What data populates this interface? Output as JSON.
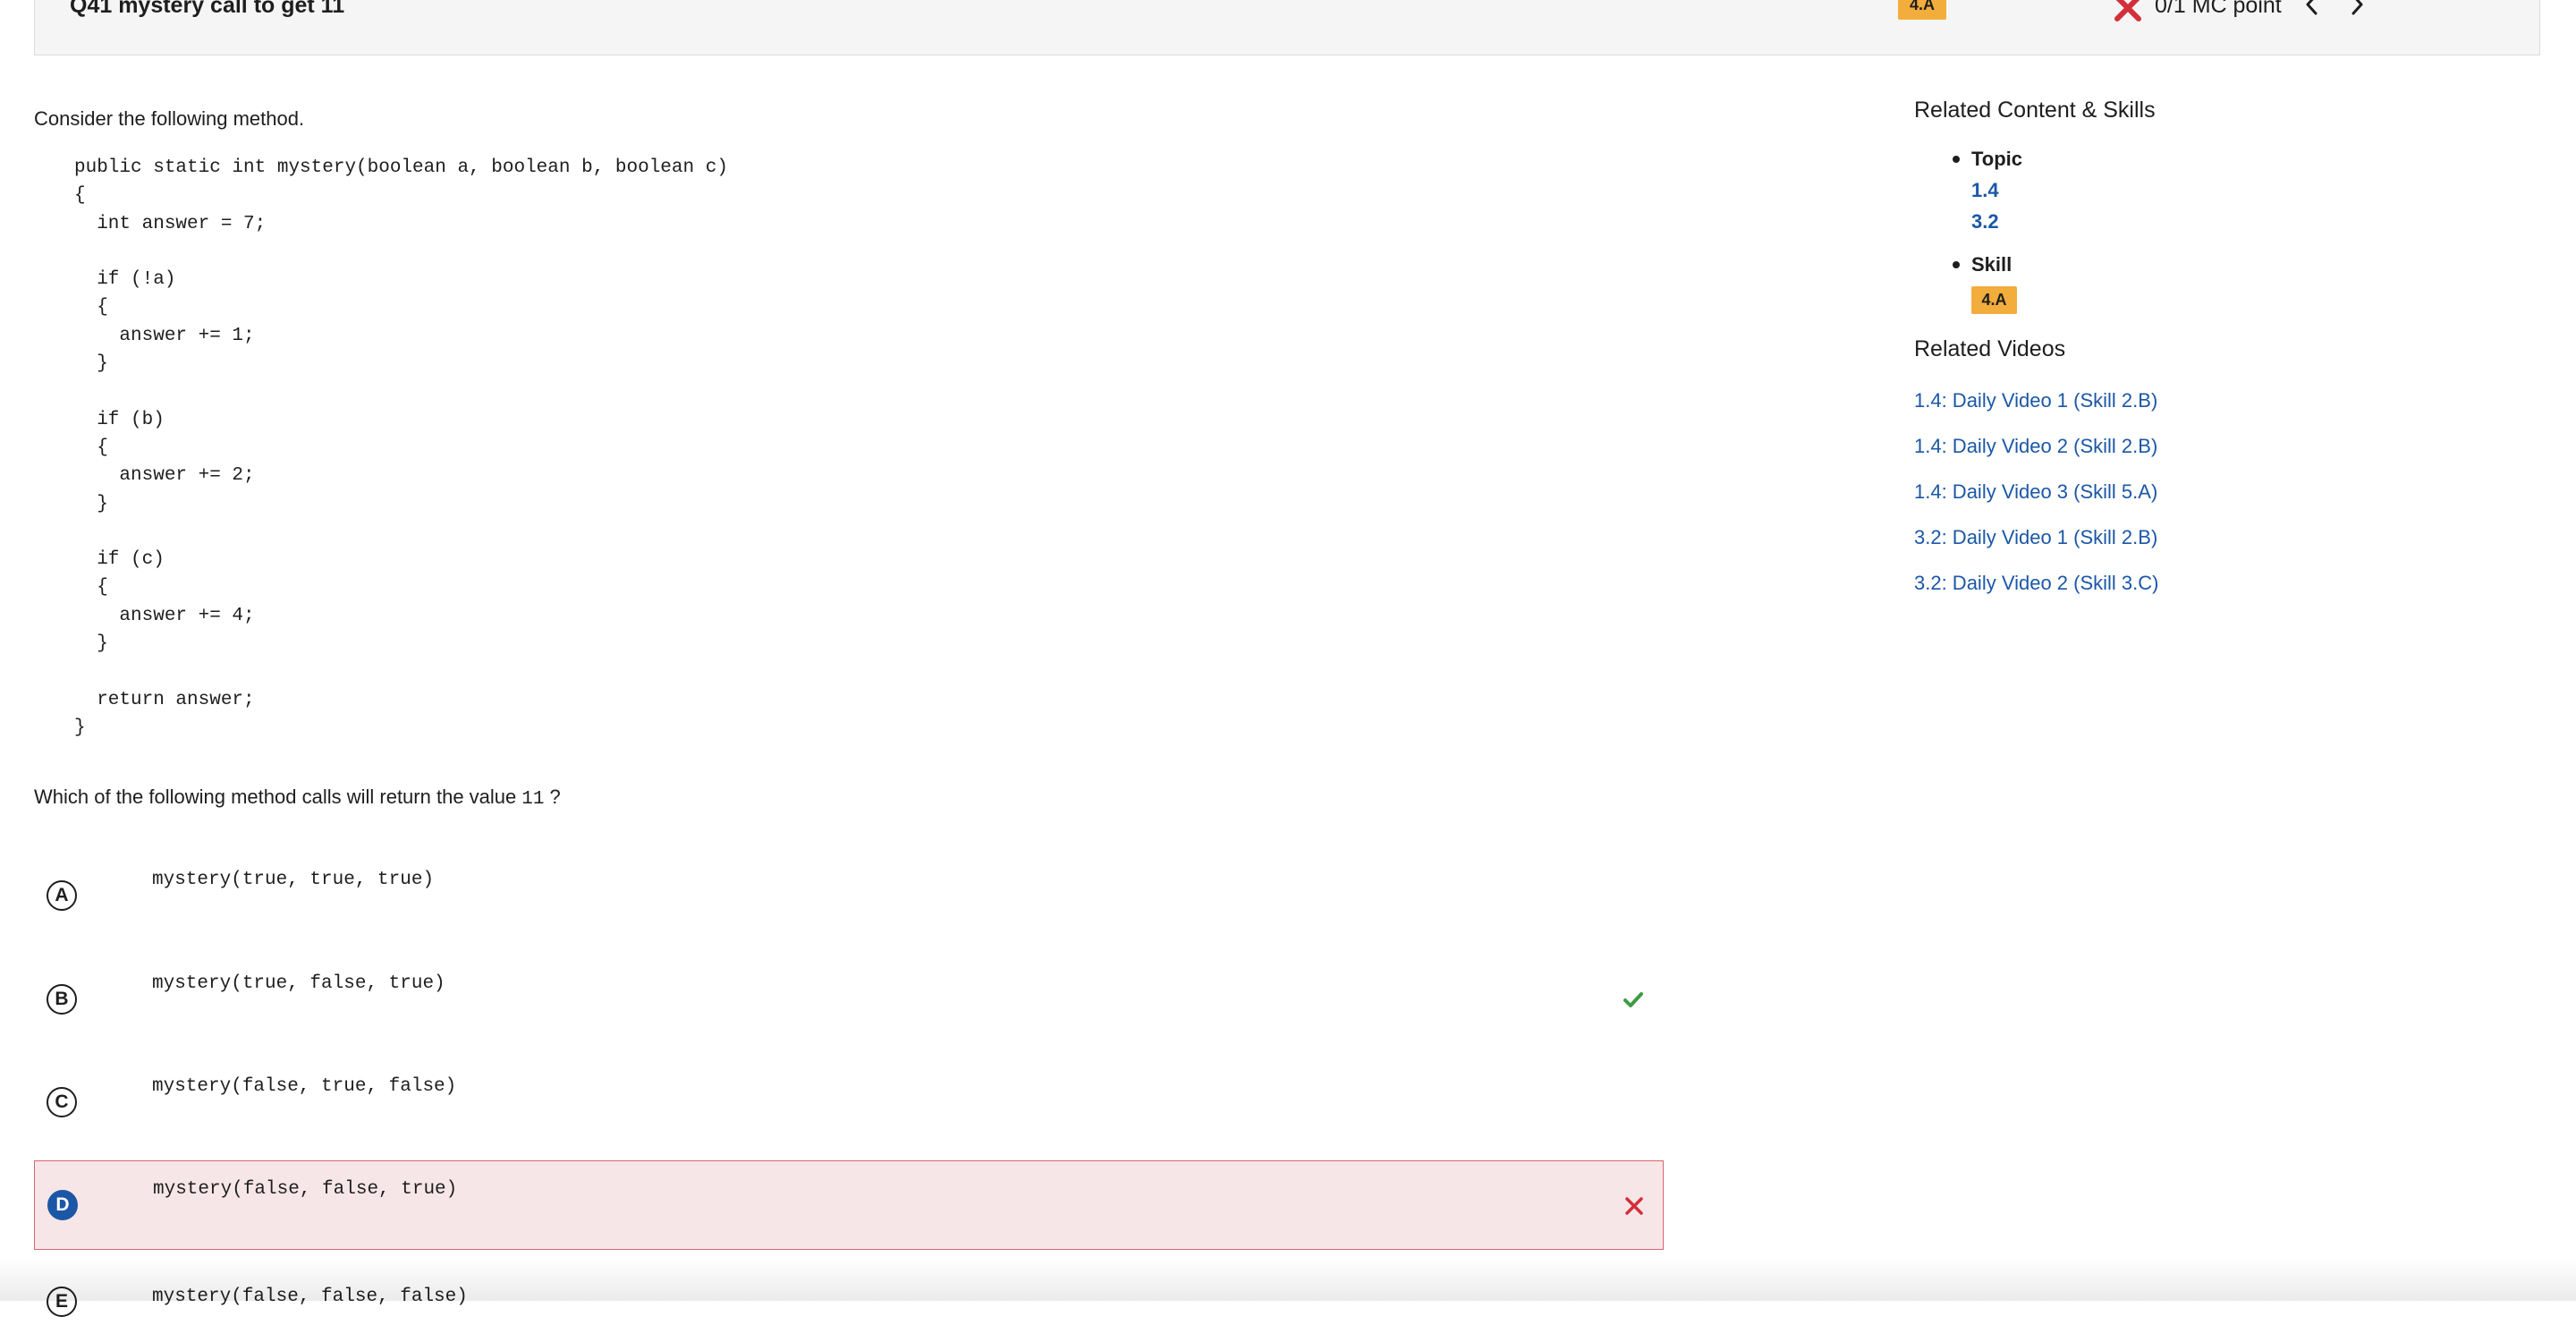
{
  "header": {
    "question_title": "Q41 mystery call to get 11",
    "skill_badge": "4.A",
    "score_text": "0/1 MC point",
    "prev_icon": "chevron-left-icon",
    "next_icon": "chevron-right-icon",
    "score_icon": "incorrect-x-icon"
  },
  "question": {
    "intro": "Consider the following method.",
    "code": "public static int mystery(boolean a, boolean b, boolean c)\n{\n  int answer = 7;\n\n  if (!a)\n  {\n    answer += 1;\n  }\n\n  if (b)\n  {\n    answer += 2;\n  }\n\n  if (c)\n  {\n    answer += 4;\n  }\n\n  return answer;\n}",
    "prompt_before": "Which of the following method calls will return the value",
    "prompt_value": "11",
    "prompt_after": "?"
  },
  "options": [
    {
      "letter": "A",
      "code": "mystery(true, true, true)"
    },
    {
      "letter": "B",
      "code": "mystery(true, false, true)",
      "mark": "correct-check-icon"
    },
    {
      "letter": "C",
      "code": "mystery(false, true, false)"
    },
    {
      "letter": "D",
      "code": "mystery(false, false, true)",
      "mark": "incorrect-x-icon",
      "selected": true
    },
    {
      "letter": "E",
      "code": "mystery(false, false, false)"
    }
  ],
  "sidebar": {
    "related_heading": "Related Content & Skills",
    "topic_label": "Topic",
    "topics": [
      "1.4",
      "3.2"
    ],
    "skill_label": "Skill",
    "skill_badge": "4.A",
    "videos_heading": "Related Videos",
    "videos": [
      "1.4: Daily Video 1 (Skill 2.B)",
      "1.4: Daily Video 2 (Skill 2.B)",
      "1.4: Daily Video 3 (Skill 5.A)",
      "3.2: Daily Video 1 (Skill 2.B)",
      "3.2: Daily Video 2 (Skill 3.C)"
    ]
  },
  "colors": {
    "badge": "#f3ad3c",
    "link": "#1b57a6",
    "incorrect": "#d32f3a",
    "correct": "#3e9b45",
    "selected_bg": "#f7e6e7"
  }
}
